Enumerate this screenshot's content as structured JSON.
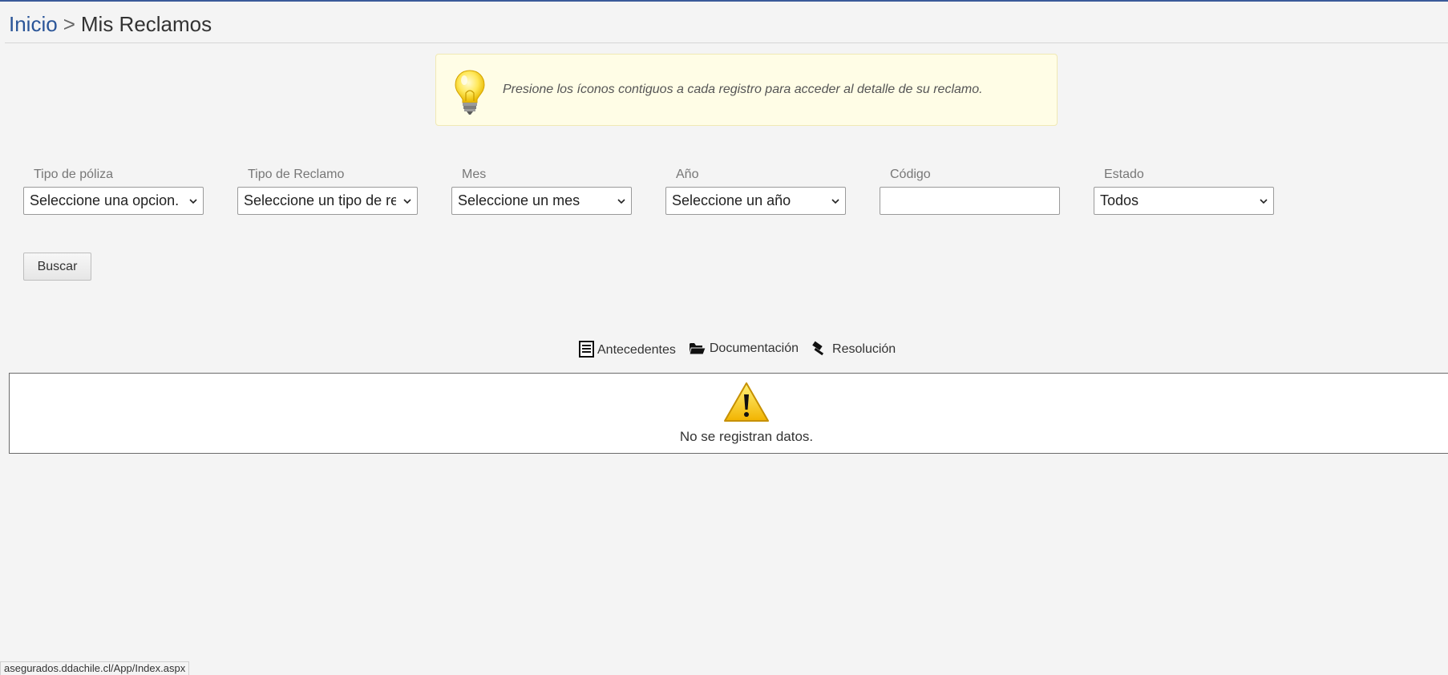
{
  "breadcrumb": {
    "home": "Inicio",
    "separator": ">",
    "current": "Mis Reclamos"
  },
  "hint": {
    "icon": "lightbulb-icon",
    "text": "Presione los íconos contiguos a cada registro para acceder al detalle de su reclamo."
  },
  "filters": {
    "policy_type": {
      "label": "Tipo de póliza",
      "value": "Seleccione una opcion."
    },
    "claim_type": {
      "label": "Tipo de Reclamo",
      "value": "Seleccione un tipo de reclamo"
    },
    "month": {
      "label": "Mes",
      "value": "Seleccione un mes"
    },
    "year": {
      "label": "Año",
      "value": "Seleccione un año"
    },
    "code": {
      "label": "Código",
      "value": ""
    },
    "status": {
      "label": "Estado",
      "value": "Todos"
    }
  },
  "search_button": "Buscar",
  "legend": {
    "background": {
      "icon": "document-list-icon",
      "label": "Antecedentes"
    },
    "documentation": {
      "icon": "open-folder-icon",
      "label": "Documentación"
    },
    "resolution": {
      "icon": "gavel-icon",
      "label": "Resolución"
    }
  },
  "results": {
    "icon": "warning-icon",
    "empty_message": "No se registran datos."
  },
  "status_bar": {
    "url": "asegurados.ddachile.cl/App/Index.aspx"
  },
  "colors": {
    "accent": "#2a5598",
    "page_background": "#f4f4f4",
    "hint_background": "#fffde6"
  }
}
